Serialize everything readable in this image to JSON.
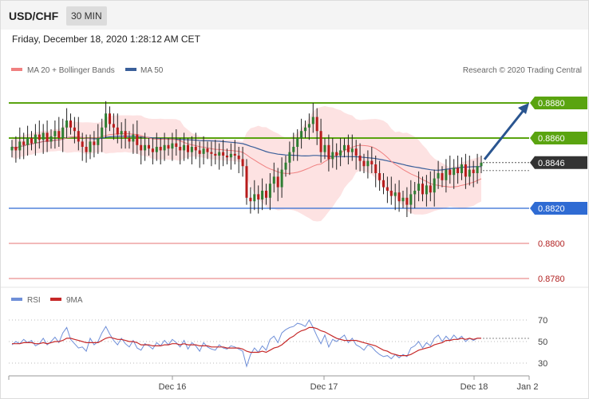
{
  "header": {
    "symbol": "USD/CHF",
    "timeframe": "30 MIN",
    "datetime": "Friday, December 18, 2020 1:28:12 AM CET"
  },
  "credit": "Research © 2020 Trading Central",
  "colors": {
    "bull_candle": "#2e7d32",
    "bear_candle": "#b71c1c",
    "bollinger_fill": "#fde2e2",
    "ma20": "#f08080",
    "ma50": "#3a5f9a",
    "resistance": "#5aa410",
    "support": "#2f6bd3",
    "target_red": "#e57373",
    "current": "#333333",
    "rsi": "#6f8fd8",
    "rsi_ma": "#c62828",
    "arrow": "#2a5590"
  },
  "chart_data": [
    {
      "type": "candlestick",
      "legend": [
        "MA 20 + Bollinger Bands",
        "MA 50"
      ],
      "ylim": [
        0.8775,
        0.8895
      ],
      "x_ticks": [
        "Dec 16",
        "Dec 17",
        "Dec 18",
        "Jan 2"
      ],
      "levels": [
        {
          "value": 0.888,
          "label": "0.8880",
          "kind": "resistance"
        },
        {
          "value": 0.886,
          "label": "0.8860",
          "kind": "resistance"
        },
        {
          "value": 0.8846,
          "label": "0.8846",
          "kind": "current"
        },
        {
          "value": 0.882,
          "label": "0.8820",
          "kind": "support"
        },
        {
          "value": 0.88,
          "label": "0.8800",
          "kind": "target"
        },
        {
          "value": 0.878,
          "label": "0.8780",
          "kind": "target"
        }
      ],
      "close": [
        0.8855,
        0.8853,
        0.8858,
        0.8856,
        0.886,
        0.8857,
        0.8862,
        0.8859,
        0.8863,
        0.8858,
        0.8861,
        0.8864,
        0.886,
        0.8866,
        0.887,
        0.8866,
        0.8864,
        0.8858,
        0.8855,
        0.8852,
        0.8858,
        0.8856,
        0.886,
        0.8866,
        0.8874,
        0.8868,
        0.8866,
        0.8862,
        0.8864,
        0.886,
        0.8858,
        0.8862,
        0.8856,
        0.8853,
        0.8856,
        0.8854,
        0.8852,
        0.8855,
        0.8853,
        0.8856,
        0.8854,
        0.8857,
        0.8855,
        0.8853,
        0.8856,
        0.8852,
        0.8855,
        0.8853,
        0.8851,
        0.8854,
        0.8852,
        0.8851,
        0.885,
        0.8852,
        0.885,
        0.8849,
        0.8851,
        0.885,
        0.8848,
        0.8844,
        0.8826,
        0.8824,
        0.8828,
        0.8825,
        0.883,
        0.8826,
        0.8834,
        0.8838,
        0.8832,
        0.8842,
        0.8846,
        0.8852,
        0.8855,
        0.886,
        0.8864,
        0.8866,
        0.8868,
        0.8872,
        0.8864,
        0.8852,
        0.8856,
        0.8848,
        0.8852,
        0.885,
        0.8853,
        0.8856,
        0.8852,
        0.8854,
        0.885,
        0.8847,
        0.8844,
        0.8847,
        0.8845,
        0.884,
        0.8836,
        0.8832,
        0.883,
        0.8827,
        0.8829,
        0.8824,
        0.8826,
        0.8822,
        0.8828,
        0.883,
        0.8834,
        0.8828,
        0.8833,
        0.8829,
        0.8837,
        0.884,
        0.8836,
        0.8842,
        0.8839,
        0.8843,
        0.884,
        0.8845,
        0.8838,
        0.8842,
        0.884,
        0.8844,
        0.8846
      ],
      "rsi": {
        "legend": [
          "RSI",
          "9MA"
        ],
        "ylim": [
          20,
          80
        ],
        "ticks": [
          70,
          50,
          30
        ],
        "rsi_values": [
          47,
          50,
          48,
          52,
          49,
          51,
          46,
          48,
          53,
          47,
          50,
          54,
          49,
          58,
          63,
          52,
          48,
          44,
          45,
          41,
          53,
          47,
          50,
          58,
          64,
          57,
          51,
          47,
          53,
          48,
          45,
          51,
          44,
          42,
          48,
          46,
          43,
          49,
          46,
          51,
          47,
          52,
          49,
          45,
          51,
          43,
          49,
          46,
          41,
          49,
          45,
          43,
          42,
          47,
          44,
          43,
          46,
          45,
          43,
          41,
          27,
          38,
          44,
          40,
          46,
          42,
          52,
          55,
          49,
          58,
          61,
          63,
          64,
          67,
          66,
          64,
          70,
          63,
          55,
          48,
          56,
          45,
          52,
          50,
          53,
          56,
          49,
          53,
          47,
          45,
          42,
          47,
          45,
          41,
          38,
          36,
          37,
          34,
          38,
          35,
          38,
          36,
          44,
          46,
          50,
          44,
          49,
          46,
          53,
          56,
          50,
          55,
          51,
          56,
          52,
          55,
          50,
          53,
          51,
          53,
          53
        ],
        "ma_values": [
          48,
          48,
          48,
          49,
          49,
          49,
          48,
          48,
          49,
          48,
          49,
          50,
          50,
          51,
          53,
          53,
          52,
          51,
          50,
          49,
          49,
          49,
          49,
          51,
          53,
          54,
          53,
          52,
          52,
          51,
          50,
          50,
          49,
          47,
          47,
          47,
          46,
          46,
          46,
          47,
          47,
          48,
          48,
          47,
          48,
          47,
          47,
          47,
          46,
          46,
          46,
          45,
          45,
          45,
          45,
          44,
          44,
          44,
          44,
          43,
          41,
          40,
          40,
          40,
          41,
          40,
          42,
          44,
          45,
          47,
          50,
          53,
          55,
          58,
          60,
          61,
          63,
          63,
          62,
          60,
          59,
          57,
          55,
          53,
          52,
          51,
          51,
          51,
          51,
          50,
          49,
          48,
          47,
          46,
          44,
          42,
          41,
          39,
          38,
          37,
          37,
          37,
          38,
          40,
          42,
          43,
          44,
          45,
          47,
          48,
          49,
          51,
          51,
          52,
          52,
          53,
          52,
          53,
          52,
          53,
          53
        ]
      }
    }
  ]
}
